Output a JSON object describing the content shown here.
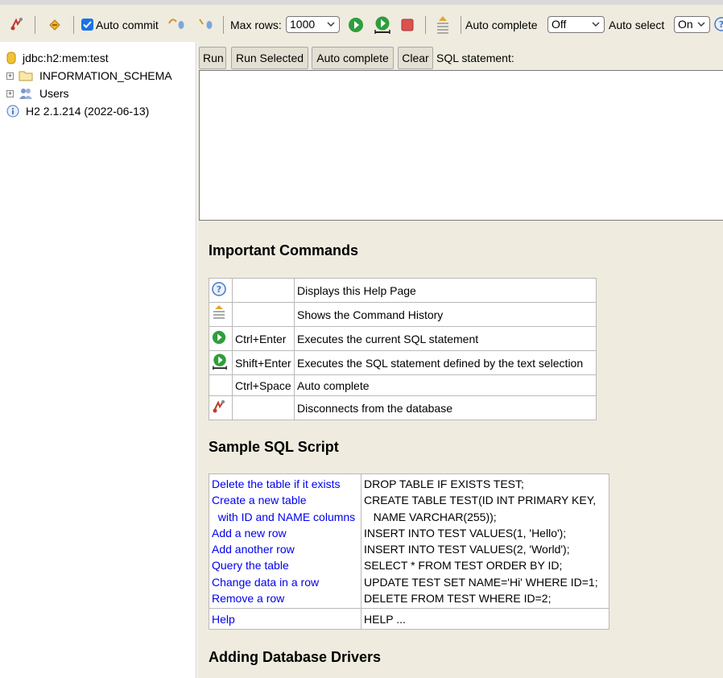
{
  "toolbar": {
    "auto_commit_label": "Auto commit",
    "auto_commit_checked": true,
    "max_rows_label": "Max rows:",
    "max_rows_value": "1000",
    "auto_complete_label": "Auto complete",
    "auto_complete_value": "Off",
    "auto_select_label": "Auto select",
    "auto_select_value": "On"
  },
  "tree": {
    "connection": "jdbc:h2:mem:test",
    "items": [
      {
        "label": "INFORMATION_SCHEMA"
      },
      {
        "label": "Users"
      }
    ],
    "version": "H2 2.1.214 (2022-06-13)"
  },
  "buttons": {
    "run": "Run",
    "run_selected": "Run Selected",
    "auto_complete": "Auto complete",
    "clear": "Clear"
  },
  "sql_label": "SQL statement:",
  "help": {
    "important_title": "Important Commands",
    "commands": [
      {
        "icon": "help-icon",
        "key": "",
        "desc": "Displays this Help Page"
      },
      {
        "icon": "history-icon",
        "key": "",
        "desc": "Shows the Command History"
      },
      {
        "icon": "run-icon",
        "key": "Ctrl+Enter",
        "desc": "Executes the current SQL statement"
      },
      {
        "icon": "run-selected-icon",
        "key": "Shift+Enter",
        "desc": "Executes the SQL statement defined by the text selection"
      },
      {
        "icon": "",
        "key": "Ctrl+Space",
        "desc": "Auto complete"
      },
      {
        "icon": "disconnect-icon",
        "key": "",
        "desc": "Disconnects from the database"
      }
    ],
    "sample_title": "Sample SQL Script",
    "samples": [
      {
        "link": "Delete the table if it exists",
        "sql": "DROP TABLE IF EXISTS TEST;"
      },
      {
        "link": "Create a new table",
        "sql": "CREATE TABLE TEST(ID INT PRIMARY KEY,"
      },
      {
        "link": "  with ID and NAME columns",
        "sql": "   NAME VARCHAR(255));"
      },
      {
        "link": "Add a new row",
        "sql": "INSERT INTO TEST VALUES(1, 'Hello');"
      },
      {
        "link": "Add another row",
        "sql": "INSERT INTO TEST VALUES(2, 'World');"
      },
      {
        "link": "Query the table",
        "sql": "SELECT * FROM TEST ORDER BY ID;"
      },
      {
        "link": "Change data in a row",
        "sql": "UPDATE TEST SET NAME='Hi' WHERE ID=1;"
      },
      {
        "link": "Remove a row",
        "sql": "DELETE FROM TEST WHERE ID=2;"
      }
    ],
    "help_row": {
      "link": "Help",
      "sql": "HELP ..."
    },
    "drivers_title": "Adding Database Drivers"
  }
}
